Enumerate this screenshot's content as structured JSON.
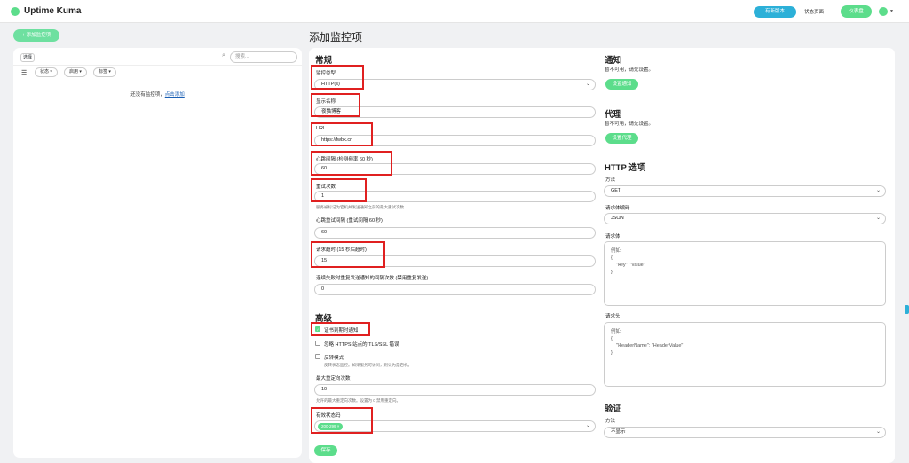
{
  "header": {
    "app_name": "Uptime Kuma",
    "new_version": "有新版本",
    "status_page": "状态页面",
    "dashboard": "仪表盘"
  },
  "sidebar": {
    "add_button": "+ 添加监控项",
    "select_label": "选择",
    "search_placeholder": "搜索...",
    "filters": [
      "状态 ▾",
      "启用 ▾",
      "标签 ▾"
    ],
    "empty_text": "还没有监控项，",
    "empty_link": "点击添加"
  },
  "page": {
    "title": "添加监控项"
  },
  "general": {
    "heading": "常规",
    "monitor_type_label": "监控类型",
    "monitor_type_value": "HTTP(s)",
    "friendly_name_label": "显示名称",
    "friendly_name_value": "夜猫博客",
    "url_label": "URL",
    "url_value": "https://fwbk.cn",
    "interval_label": "心跳间隔 (检测频率 60 秒)",
    "interval_value": "60",
    "retries_label": "重试次数",
    "retries_value": "1",
    "retries_hint": "服务被标记为宕机并发送通知之前的最大重试次数",
    "retry_interval_label": "心跳重试间隔 (重试间隔 60 秒)",
    "retry_interval_value": "60",
    "timeout_label": "请求超时 (15 秒后超时)",
    "timeout_value": "15",
    "resend_label": "连续失败时重复发送通知的间隔次数 (禁用重复发送)",
    "resend_value": "0"
  },
  "advanced": {
    "heading": "高级",
    "cert_expiry_label": "证书到期时通知",
    "ignore_tls_label": "忽略 HTTPS 站点的 TLS/SSL 错误",
    "upside_down_label": "反转模式",
    "upside_down_hint": "反转状态监控。如果服务可访问，则认为是宕机。",
    "max_redirects_label": "最大重定向次数",
    "max_redirects_value": "10",
    "max_redirects_hint": "允许的最大重定向次数。设置为 0 禁用重定向。",
    "accepted_codes_label": "有效状态码",
    "accepted_code_tag": "200-299 ×",
    "save_button": "保存"
  },
  "notifications": {
    "heading": "通知",
    "none_text": "暂不可用，请先设置。",
    "setup_button": "设置通知"
  },
  "proxy": {
    "heading": "代理",
    "none_text": "暂不可用，请先设置。",
    "setup_button": "设置代理"
  },
  "http_options": {
    "heading": "HTTP 选项",
    "method_label": "方法",
    "method_value": "GET",
    "body_encoding_label": "请求体编码",
    "body_encoding_value": "JSON",
    "body_label": "请求体",
    "body_placeholder": "例如:\n{\n    \"key\": \"value\"\n}",
    "headers_label": "请求头",
    "headers_placeholder": "例如:\n{\n    \"HeaderName\": \"HeaderValue\"\n}"
  },
  "auth": {
    "heading": "验证",
    "method_label": "方法",
    "method_value": "不显示"
  },
  "colors": {
    "accent": "#5cdd8b",
    "info": "#2cb0d8",
    "highlight": "#e02020"
  }
}
